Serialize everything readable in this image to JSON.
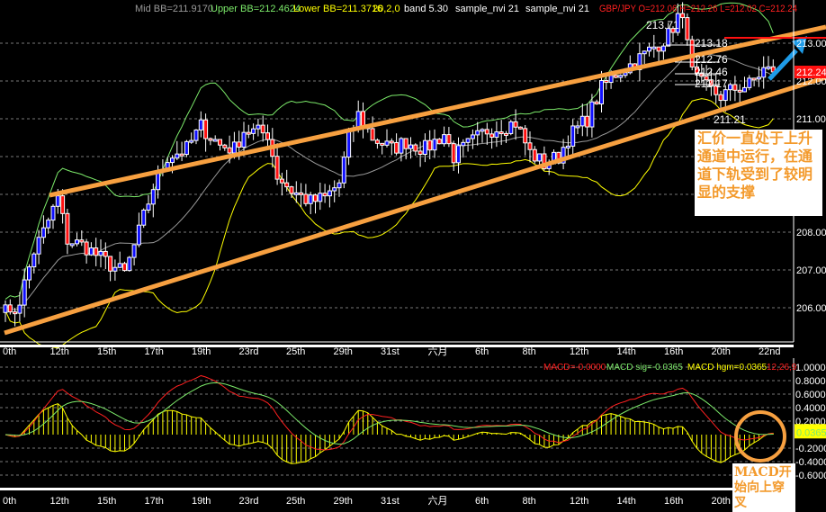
{
  "header": {
    "mid_bb": "Mid BB=211.9170",
    "upper_bb": "Upper BB=212.4624",
    "lower_bb": "Lower BB=211.3716",
    "bb_params": "20,2,0",
    "band": "band  5.30",
    "sample1": "sample_nvi  21",
    "sample2": "sample_nvi  21",
    "quote": "GBP/JPY O=212.06 H=212.26 L=212.02 C=212.24"
  },
  "colors": {
    "up": "#1010ff",
    "down": "#ff1010",
    "mid": "#9a9a9a",
    "upper": "#7cea6a",
    "lower": "#ffff00",
    "channel": "#f7a040",
    "macd": "#ff2020",
    "signal": "#7cea6a",
    "hist": "#ffff00",
    "arrow": "#1e9be8"
  },
  "chart_data": {
    "type": "candlestick",
    "symbol": "GBP/JPY",
    "price_path": [
      [
        0,
        206.3
      ],
      [
        1,
        205.7
      ],
      [
        3,
        206.2
      ],
      [
        6,
        207.5
      ],
      [
        8,
        208.0
      ],
      [
        11,
        208.9
      ],
      [
        13,
        207.8
      ],
      [
        17,
        207.6
      ],
      [
        20,
        207.3
      ],
      [
        25,
        206.9
      ],
      [
        28,
        208.0
      ],
      [
        31,
        209.2
      ],
      [
        34,
        210.0
      ],
      [
        38,
        210.2
      ],
      [
        41,
        210.8
      ],
      [
        45,
        210.3
      ],
      [
        48,
        210.2
      ],
      [
        50,
        210.7
      ],
      [
        55,
        210.6
      ],
      [
        57,
        209.5
      ],
      [
        60,
        209.1
      ],
      [
        64,
        208.8
      ],
      [
        67,
        208.9
      ],
      [
        70,
        209.3
      ],
      [
        72,
        210.5
      ],
      [
        74,
        211.1
      ],
      [
        77,
        210.5
      ],
      [
        81,
        210.2
      ],
      [
        84,
        210.4
      ],
      [
        88,
        210.2
      ],
      [
        92,
        210.6
      ],
      [
        94,
        210.0
      ],
      [
        98,
        210.4
      ],
      [
        101,
        210.7
      ],
      [
        107,
        210.9
      ],
      [
        110,
        210.1
      ],
      [
        113,
        209.8
      ],
      [
        116,
        210.0
      ],
      [
        118,
        210.5
      ],
      [
        122,
        211.0
      ],
      [
        125,
        211.8
      ],
      [
        128,
        212.2
      ],
      [
        132,
        212.5
      ],
      [
        135,
        212.8
      ],
      [
        139,
        213.2
      ],
      [
        141,
        213.7
      ],
      [
        143,
        213.3
      ],
      [
        144,
        212.2
      ],
      [
        146,
        211.9
      ],
      [
        150,
        211.6
      ],
      [
        153,
        211.8
      ],
      [
        156,
        211.9
      ],
      [
        159,
        212.3
      ],
      [
        161,
        212.24
      ]
    ],
    "price_axis": {
      "ticks": [
        "213.00",
        "212.00",
        "211.00",
        "208.00",
        "207.00",
        "206.00"
      ],
      "last": "212.24"
    },
    "price_labels": [
      "213.71",
      "213.18",
      "212.76",
      "212.46",
      "212.17",
      "211.21"
    ],
    "x_ticks": [
      "0th",
      "12th",
      "15th",
      "17th",
      "19th",
      "23rd",
      "25th",
      "29th",
      "31st",
      "六月",
      "6th",
      "8th",
      "12th",
      "14th",
      "16th",
      "20th",
      "22nd"
    ],
    "indicators": [
      "Bollinger Bands (20,2)",
      "MACD (12,26,9)"
    ],
    "macd": {
      "legend_macd": "MACD=-0.0000",
      "legend_sig": "MACD sig=-0.0365",
      "legend_hgm": "MACD hgm=0.0365",
      "params": "12,26,9",
      "axis": [
        "1.0000",
        "0.8000",
        "0.6000",
        "0.4000",
        "0.2000",
        "0.0365",
        "-0.2000",
        "-0.4000",
        "-0.6000"
      ]
    }
  },
  "annotations": {
    "channel_note": "汇价一直处于上升通道中运行，在通道下轨受到了较明显的支撑",
    "macd_note": "MACD开始向上穿叉"
  }
}
